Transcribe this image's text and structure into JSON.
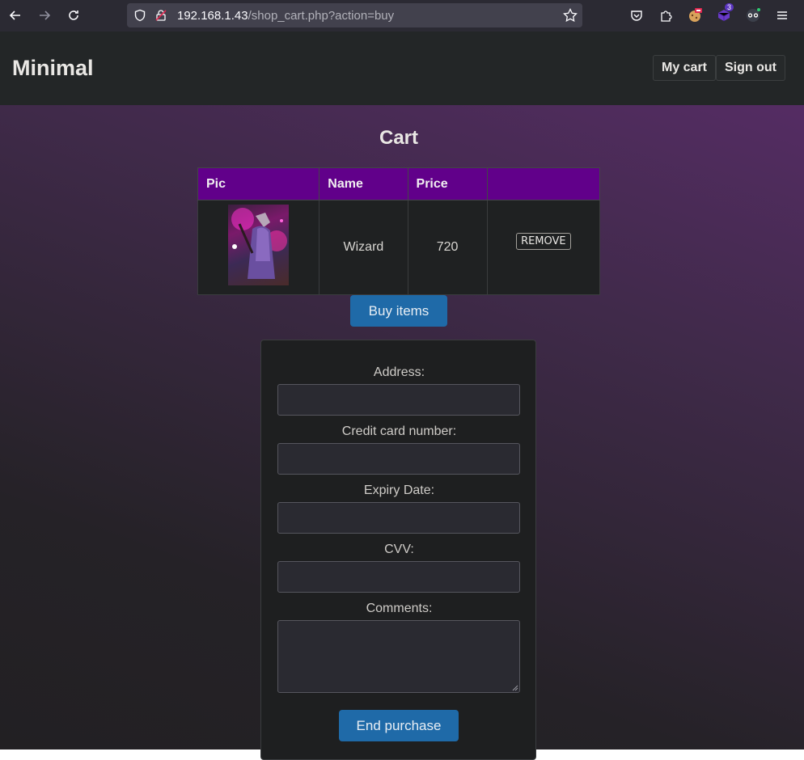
{
  "browser": {
    "url_host": "192.168.1.43",
    "url_path": "/shop_cart.php?action=buy",
    "extension_badge": "3"
  },
  "header": {
    "brand": "Minimal",
    "my_cart": "My cart",
    "sign_out": "Sign out"
  },
  "cart": {
    "title": "Cart",
    "columns": [
      "Pic",
      "Name",
      "Price",
      ""
    ],
    "rows": [
      {
        "name": "Wizard",
        "price": "720",
        "remove": "REMOVE",
        "image_icon": "wizard-thumbnail"
      }
    ],
    "buy_label": "Buy items"
  },
  "form": {
    "address_label": "Address:",
    "card_label": "Credit card number:",
    "expiry_label": "Expiry Date:",
    "cvv_label": "CVV:",
    "comments_label": "Comments:",
    "submit_label": "End purchase"
  }
}
